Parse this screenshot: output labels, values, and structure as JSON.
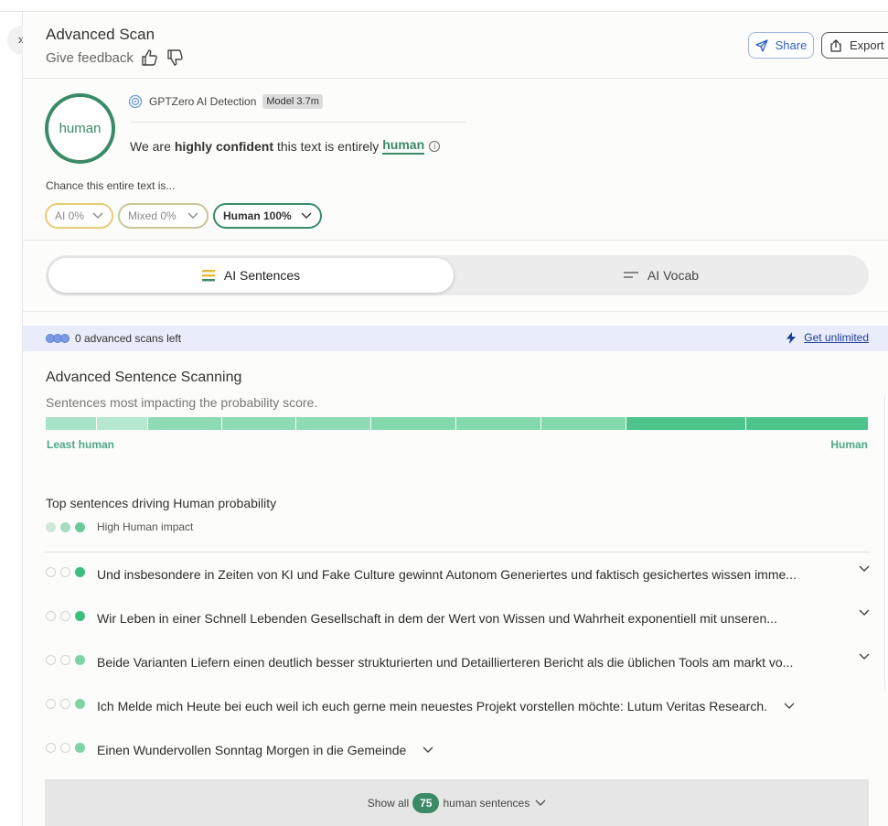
{
  "header": {
    "title": "Advanced Scan",
    "feedback_label": "Give feedback",
    "share_label": "Share",
    "export_label": "Export"
  },
  "result": {
    "verdict": "human",
    "detector_name": "GPTZero AI Detection",
    "model_badge": "Model 3.7m",
    "confidence_prefix": "We are",
    "confidence_bold": "highly confident",
    "confidence_mid": "this text is entirely",
    "confidence_class": "human",
    "chance_label": "Chance this entire text is...",
    "pills": {
      "ai": "AI 0%",
      "mixed": "Mixed 0%",
      "human": "Human 100%"
    }
  },
  "tabs": {
    "active": "AI Sentences",
    "inactive": "AI Vocab"
  },
  "scans": {
    "remaining_text": "0 advanced scans left",
    "cta": "Get unlimited"
  },
  "advanced": {
    "title": "Advanced Sentence Scanning",
    "subtitle": "Sentences most impacting the probability score.",
    "scale_left": "Least human",
    "scale_right": "Human"
  },
  "top_sentences": {
    "title": "Top sentences driving Human probability",
    "impact_label": "High Human impact",
    "items": [
      {
        "text": "Und insbesondere in Zeiten von KI und Fake Culture gewinnt Autonom Generiertes und faktisch gesichertes wissen imme...",
        "impact": "full"
      },
      {
        "text": "Wir Leben in einer Schnell Lebenden Gesellschaft in dem der Wert von Wissen und Wahrheit exponentiell mit unseren...",
        "impact": "full"
      },
      {
        "text": "Beide Varianten Liefern einen deutlich besser strukturierten und Detaillierteren Bericht als die üblichen Tools am markt vo...",
        "impact": "mid"
      },
      {
        "text": "Ich Melde mich Heute bei euch weil ich euch gerne mein neuestes Projekt vorstellen möchte: Lutum Veritas Research.",
        "impact": "mid"
      },
      {
        "text": "Einen Wundervollen Sonntag Morgen in die Gemeinde",
        "impact": "mid"
      }
    ],
    "show_all_prefix": "Show all",
    "show_all_count": "75",
    "show_all_suffix": "human sentences"
  },
  "colors": {
    "human_green": "#3a8a67",
    "ai_yellow": "#e8cc7a",
    "link_blue": "#1d3e97"
  }
}
